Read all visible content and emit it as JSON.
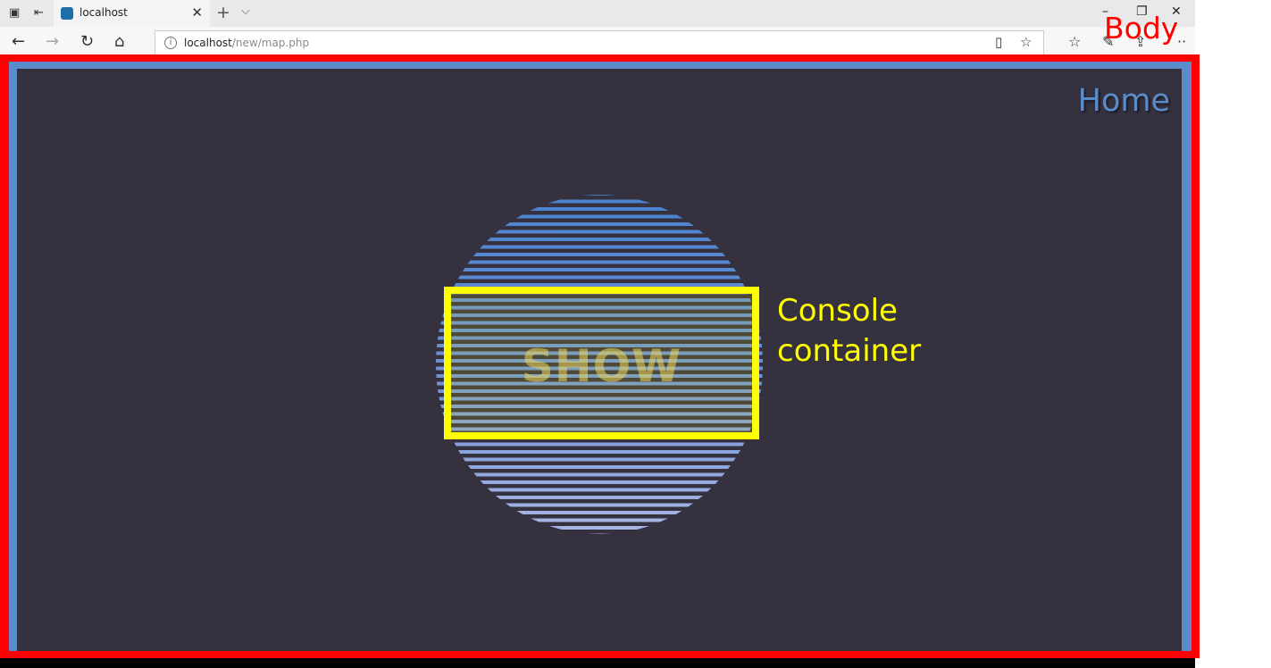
{
  "browser": {
    "tab_title": "localhost",
    "url_host": "localhost",
    "url_path": "/new/map.php"
  },
  "page": {
    "home_label": "Home",
    "show_label": "SHOW"
  },
  "annotations": {
    "body_label": "Body",
    "console_label_line1": "Console",
    "console_label_line2": "container"
  },
  "colors": {
    "page_background": "#36313f",
    "page_border": "#5b8cc9",
    "body_outline": "#ff0000",
    "console_outline": "#ffff00"
  },
  "icons": {
    "tab_favicon": "localhost-favicon-icon",
    "back": "back-arrow-icon",
    "forward": "forward-arrow-icon",
    "refresh": "refresh-icon",
    "home": "home-icon",
    "info": "site-info-icon",
    "reading_view": "reading-view-icon",
    "favorite": "star-icon",
    "favorites_hub": "favorites-icon",
    "notes": "pen-icon",
    "share": "share-icon",
    "more": "more-icon"
  }
}
